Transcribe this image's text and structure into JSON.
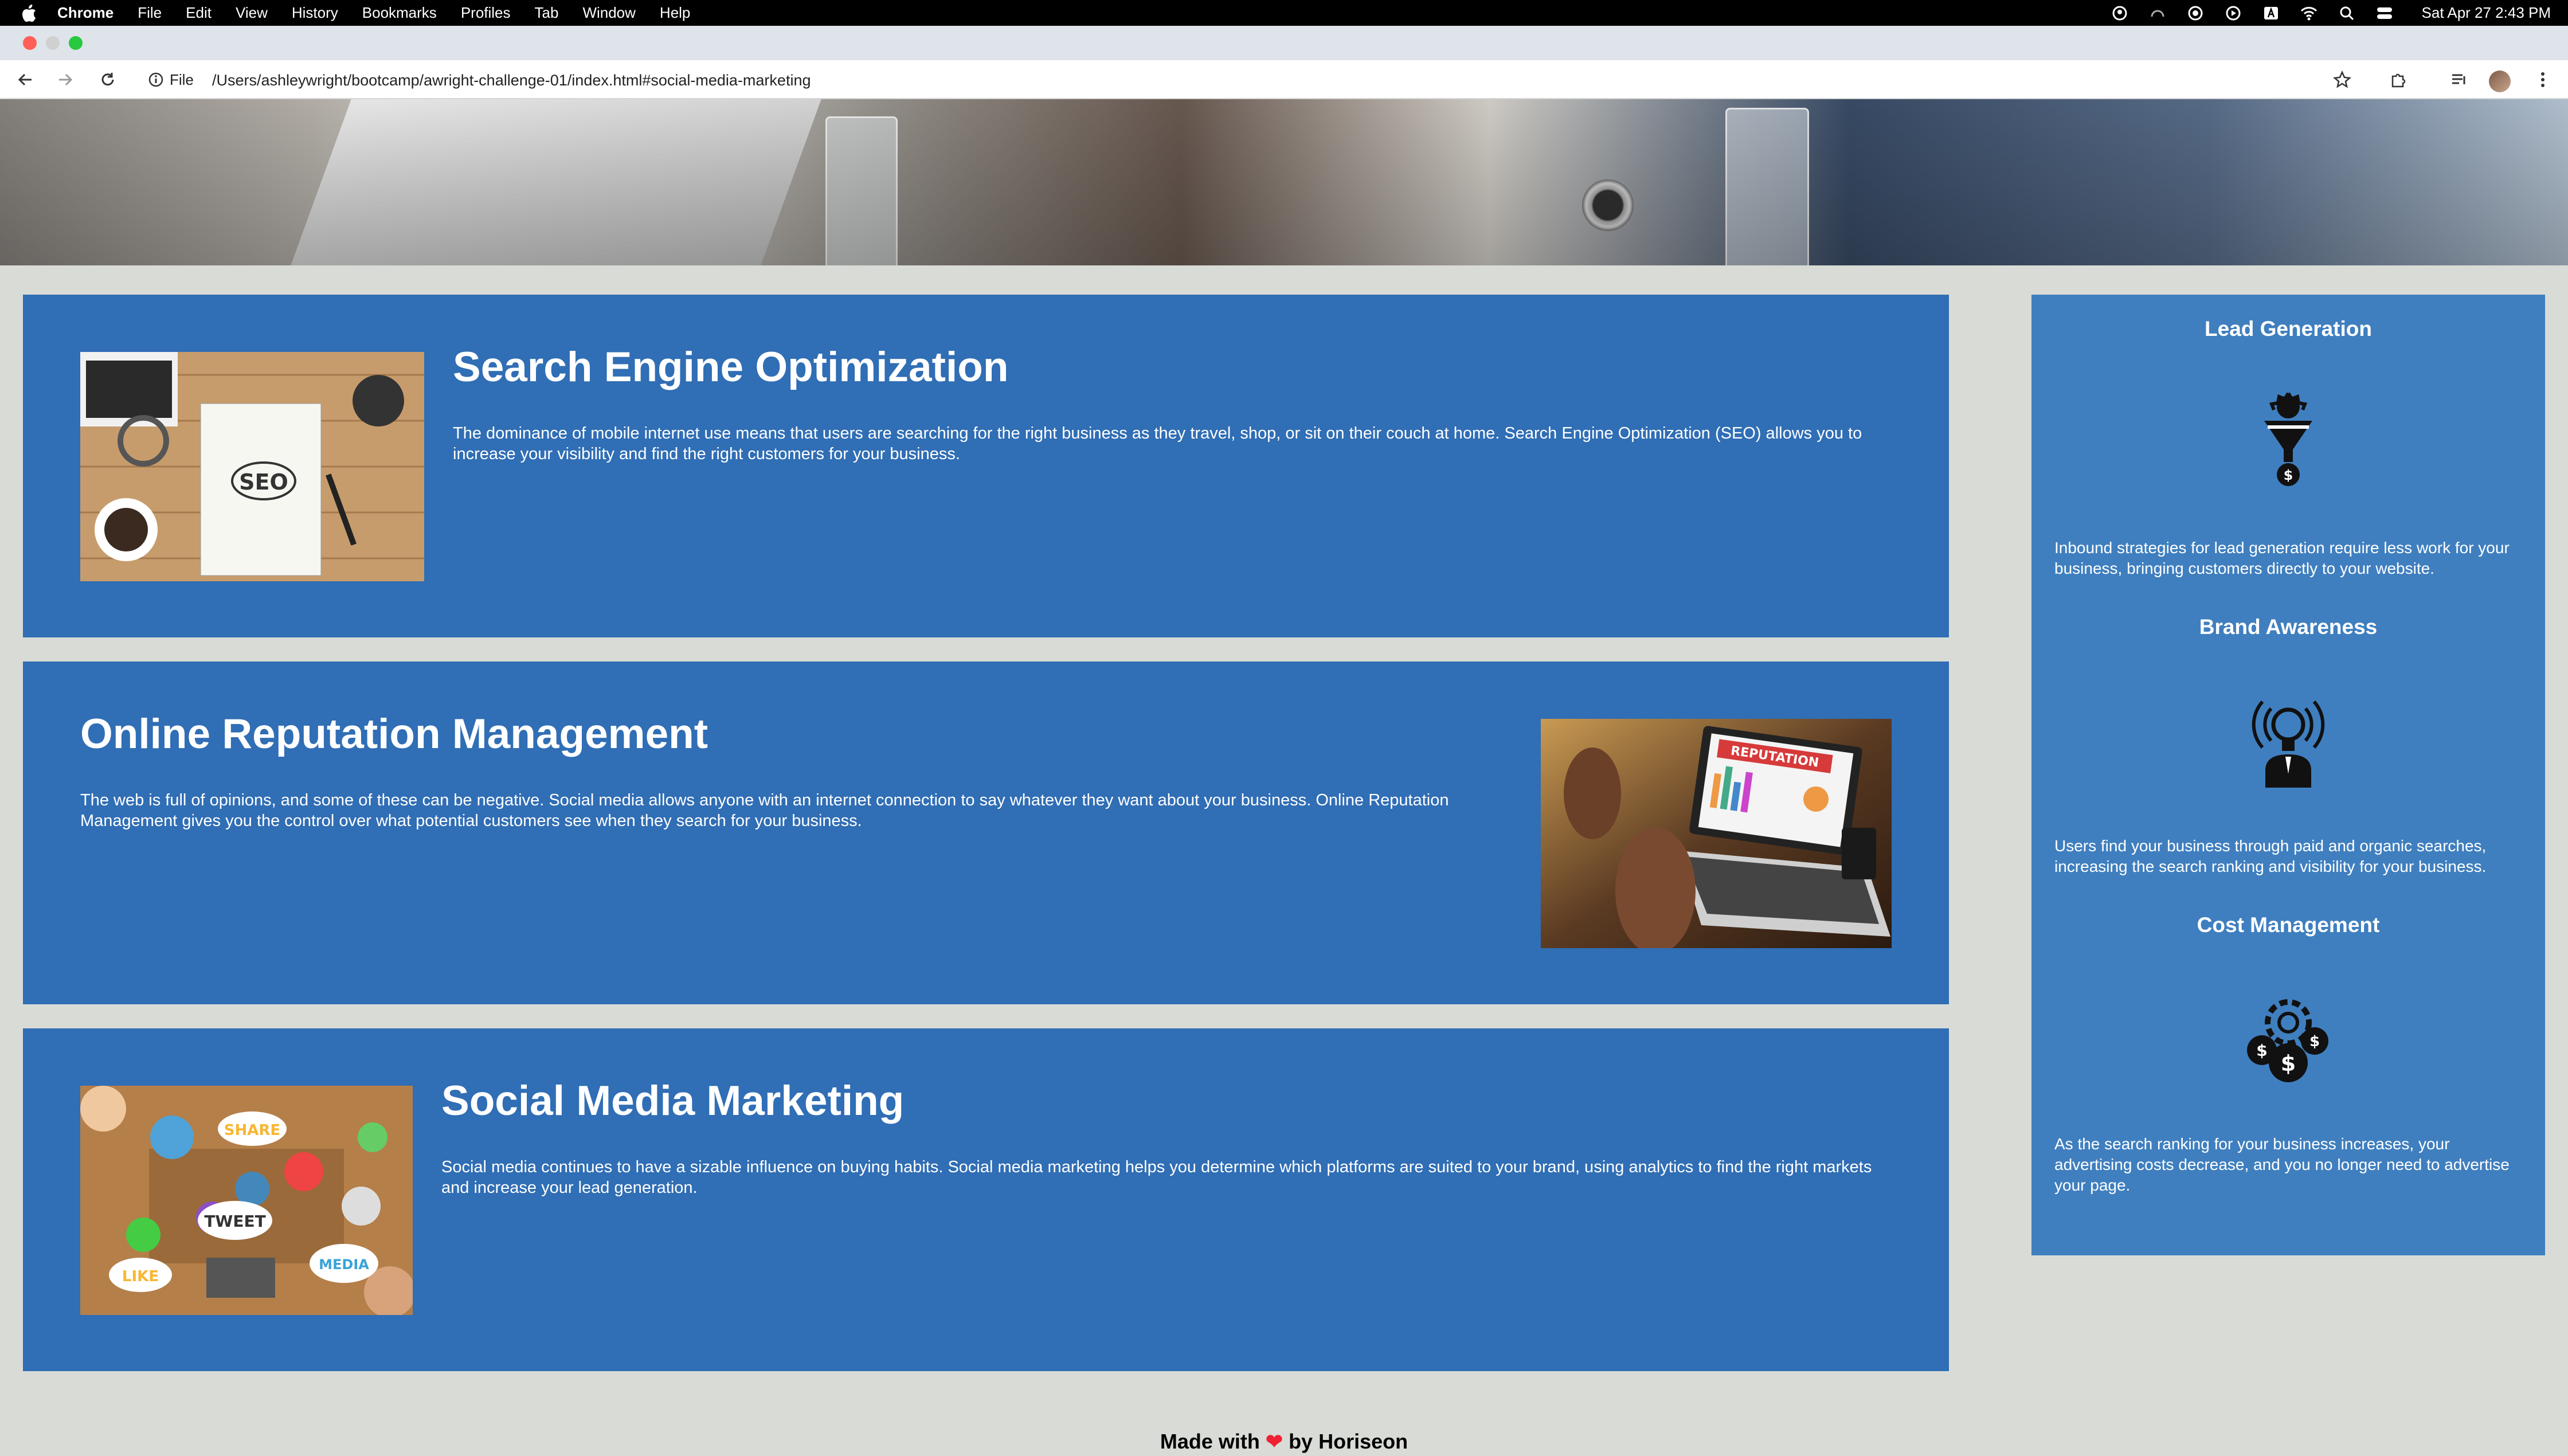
{
  "menubar": {
    "app": "Chrome",
    "items": [
      "File",
      "Edit",
      "View",
      "History",
      "Bookmarks",
      "Profiles",
      "Tab",
      "Window",
      "Help"
    ],
    "clock": "Sat Apr 27  2:43 PM"
  },
  "toolbar": {
    "file_label": "File",
    "url": "/Users/ashleywright/bootcamp/awright-challenge-01/index.html#social-media-marketing"
  },
  "content": {
    "seo": {
      "title": "Search Engine Optimization",
      "text": "The dominance of mobile internet use means that users are searching for the right business as they travel, shop, or sit on their couch at home. Search Engine Optimization (SEO) allows you to increase your visibility and find the right customers for your business."
    },
    "reputation": {
      "title": "Online Reputation Management",
      "text": "The web is full of opinions, and some of these can be negative. Social media allows anyone with an internet connection to say whatever they want about your business. Online Reputation Management gives you the control over what potential customers see when they search for your business."
    },
    "social": {
      "title": "Social Media Marketing",
      "text": "Social media continues to have a sizable influence on buying habits. Social media marketing helps you determine which platforms are suited to your brand, using analytics to find the right markets and increase your lead generation."
    }
  },
  "aside": {
    "lead": {
      "title": "Lead Generation",
      "text": "Inbound strategies for lead generation require less work for your business, bringing customers directly to your website."
    },
    "brand": {
      "title": "Brand Awareness",
      "text": "Users find your business through paid and organic searches, increasing the search ranking and visibility for your business."
    },
    "cost": {
      "title": "Cost Management",
      "text": "As the search ranking for your business increases, your advertising costs decrease, and you no longer need to advertise your page."
    }
  },
  "footer": {
    "before": "Made with ",
    "after": " by Horiseon"
  }
}
